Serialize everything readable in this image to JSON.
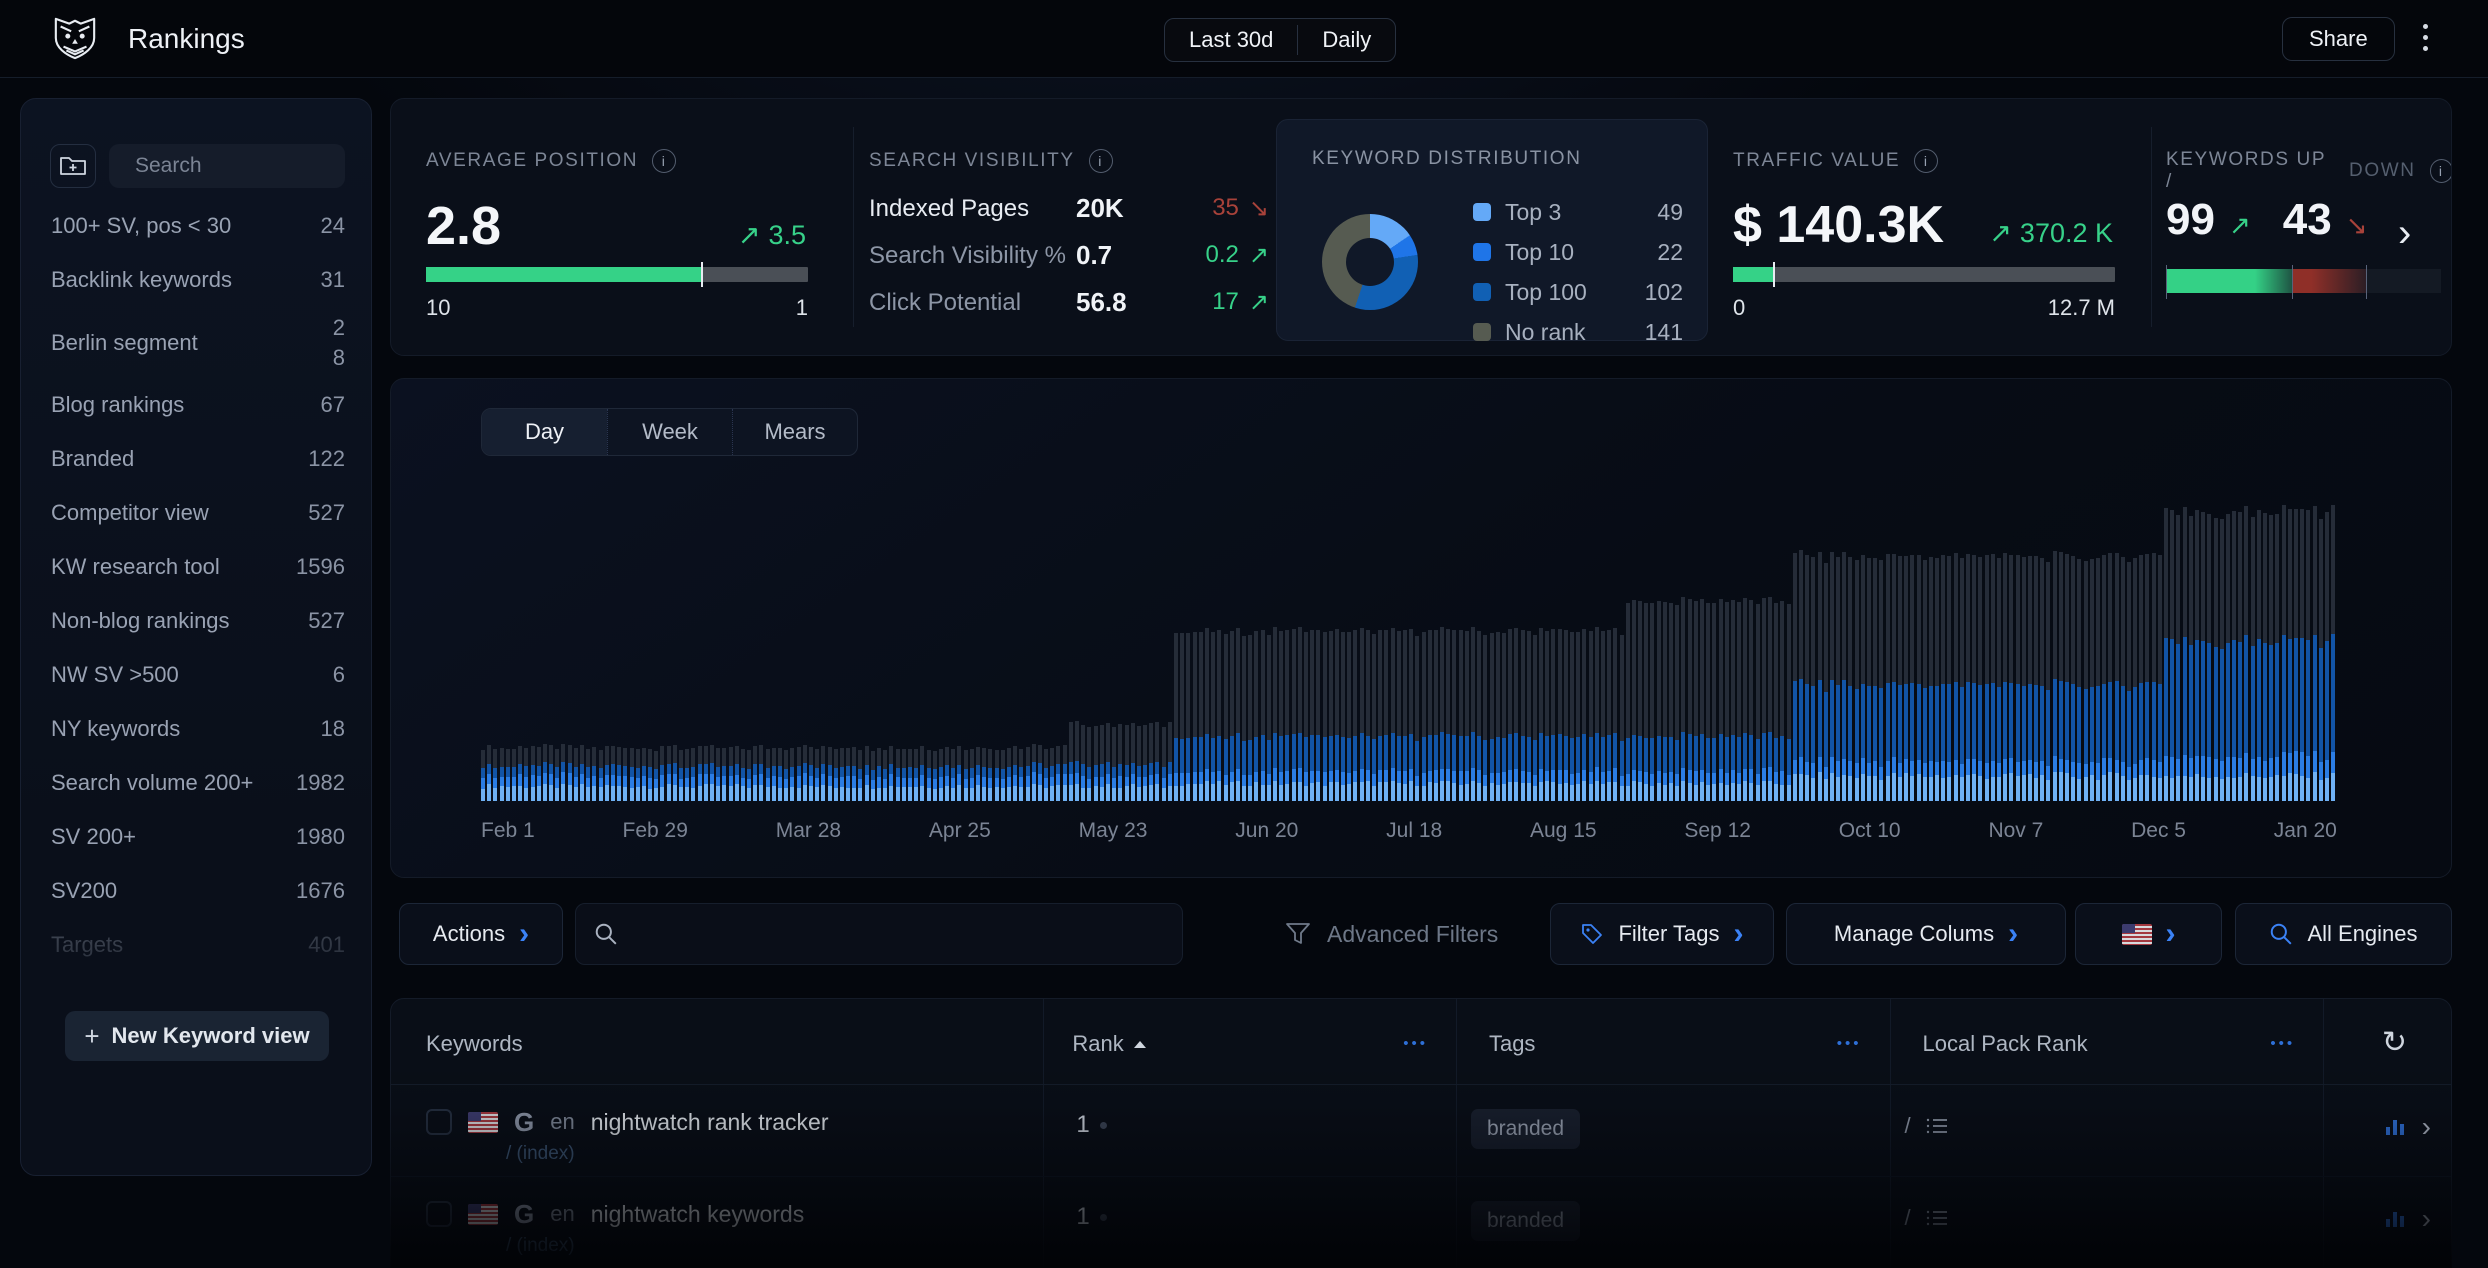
{
  "topbar": {
    "title": "Rankings",
    "range_label": "Last 30d",
    "interval_label": "Daily",
    "share_label": "Share"
  },
  "icons": {
    "arrow_up": "↗",
    "arrow_down": "↘",
    "chevron_right": "›",
    "refresh": "↻",
    "plus": "+",
    "more_dots": "•••",
    "slash": "/"
  },
  "colors": {
    "positive_green": "#37d189",
    "negative_red": "#a8423a",
    "accent_blue": "#3b82f6"
  },
  "sidebar": {
    "search_placeholder": "Search",
    "items": [
      {
        "label": "100+ SV, pos < 30",
        "count": "24"
      },
      {
        "label": "Backlink keywords",
        "count": "31"
      },
      {
        "label": "Berlin segment",
        "counts": [
          "2",
          "8"
        ]
      },
      {
        "label": "Blog rankings",
        "count": "67"
      },
      {
        "label": "Branded",
        "count": "122"
      },
      {
        "label": "Competitor view",
        "count": "527"
      },
      {
        "label": "KW research tool",
        "count": "1596"
      },
      {
        "label": "Non-blog rankings",
        "count": "527"
      },
      {
        "label": "NW SV >500",
        "count": "6"
      },
      {
        "label": "NY keywords",
        "count": "18"
      },
      {
        "label": "Search volume 200+",
        "count": "1982"
      },
      {
        "label": "SV 200+",
        "count": "1980"
      },
      {
        "label": "SV200",
        "count": "1676"
      },
      {
        "label": "Targets",
        "count": "401",
        "muted": true
      }
    ],
    "new_view_label": "New Keyword view"
  },
  "metrics": {
    "average_position": {
      "title": "AVERAGE POSITION",
      "value": "2.8",
      "delta": "3.5",
      "dir": "up",
      "bar_fill_pct": 72,
      "scale_left": "10",
      "scale_right": "1"
    },
    "search_visibility": {
      "title": "SEARCH VISIBILITY",
      "rows": [
        {
          "label": "Indexed Pages",
          "value": "20K",
          "delta": "35",
          "dir": "down"
        },
        {
          "label": "Search Visibility %",
          "value": "0.7",
          "delta": "0.2",
          "dir": "up"
        },
        {
          "label": "Click Potential",
          "value": "56.8",
          "delta": "17",
          "dir": "up"
        }
      ]
    },
    "keyword_distribution": {
      "title": "KEYWORD DISTRIBUTION"
    },
    "traffic_value": {
      "title": "TRAFFIC VALUE",
      "value": "$ 140.3K",
      "delta": "370.2 K",
      "dir": "up",
      "bar_fill_pct": 10.5,
      "scale_left": "0",
      "scale_right": "12.7 M"
    },
    "keywords_up_down": {
      "title_main": "KEYWORDS UP /",
      "title_muted": "DOWN",
      "up": "99",
      "down": "43",
      "bar": {
        "up_pct": 46,
        "down_pct": 27,
        "rest_pct": 22
      }
    }
  },
  "chart_data": {
    "donut": {
      "type": "pie",
      "title": "KEYWORD DISTRIBUTION",
      "segments": [
        {
          "label": "Top 3",
          "value": 49,
          "color": "#64a9f7"
        },
        {
          "label": "Top 10",
          "value": 22,
          "color": "#1f75e8"
        },
        {
          "label": "Top 100",
          "value": 102,
          "color": "#1160b4"
        },
        {
          "label": "No rank",
          "value": 141,
          "color": "#565b51"
        }
      ]
    },
    "rank_timeline": {
      "type": "bar",
      "stacked": true,
      "tabs": [
        "Day",
        "Week",
        "Mears"
      ],
      "active_tab": "Day",
      "x_labels": [
        "Feb 1",
        "Feb 29",
        "Mar 28",
        "Apr 25",
        "May 23",
        "Jun 20",
        "Jul 18",
        "Aug 15",
        "Sep 12",
        "Oct 10",
        "Nov 7",
        "Dec 5",
        "Jan 20"
      ],
      "total_days": 354,
      "y_unit": "keywords (approx, axis unlabeled)",
      "series_order": [
        "No rank",
        "Top 100",
        "Top 10",
        "Top 3"
      ],
      "colors": {
        "Top 3": "#6fb1f4",
        "Top 10": "#2b7de4",
        "Top 100": "#1254a6",
        "No rank": "#252c38"
      },
      "periods": [
        {
          "from_day": 0,
          "to_day": 112,
          "top3": 16,
          "top10": 11,
          "top100": 11,
          "norank": 20
        },
        {
          "from_day": 112,
          "to_day": 132,
          "top3": 16,
          "top10": 11,
          "top100": 13,
          "norank": 43
        },
        {
          "from_day": 132,
          "to_day": 218,
          "top3": 19,
          "top10": 13,
          "top100": 38,
          "norank": 114
        },
        {
          "from_day": 218,
          "to_day": 250,
          "top3": 19,
          "top10": 13,
          "top100": 38,
          "norank": 146
        },
        {
          "from_day": 250,
          "to_day": 322,
          "top3": 27,
          "top10": 16,
          "top100": 83,
          "norank": 139
        },
        {
          "from_day": 322,
          "to_day": 354,
          "top3": 27,
          "top10": 22,
          "top100": 125,
          "norank": 140
        }
      ]
    }
  },
  "toolbar": {
    "actions_label": "Actions",
    "search_placeholder": "",
    "advanced_filters_label": "Advanced Filters",
    "filter_tags_label": "Filter Tags",
    "manage_columns_label": "Manage Colums",
    "all_engines_label": "All Engines"
  },
  "table": {
    "columns": [
      "Keywords",
      "Rank",
      "Tags",
      "Local Pack Rank"
    ],
    "sort_column": "Rank",
    "rows": [
      {
        "lang": "en",
        "keyword": "nightwatch rank tracker",
        "url": "/ (index)",
        "rank": "1",
        "tags": [
          "branded"
        ],
        "local_pack": "/"
      },
      {
        "lang": "en",
        "keyword": "nightwatch keywords",
        "url": "/ (index)",
        "rank": "1",
        "tags": [
          "branded"
        ],
        "local_pack": "/"
      }
    ]
  }
}
